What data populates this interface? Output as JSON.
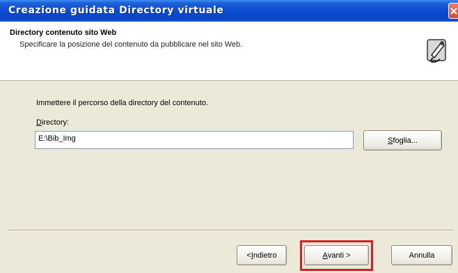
{
  "window": {
    "title": "Creazione guidata Directory virtuale"
  },
  "header": {
    "title": "Directory contenuto sito Web",
    "subtitle": "Specificare la posizione del contenuto da pubblicare nel sito Web."
  },
  "content": {
    "instruction": "Immettere il percorso della directory del contenuto.",
    "directory_label_first": "D",
    "directory_label_rest": "irectory:",
    "directory_value": "E:\\Bib_Img",
    "browse_first": "S",
    "browse_rest": "foglia..."
  },
  "footer": {
    "back_prefix": "< ",
    "back_first": "I",
    "back_rest": "ndietro",
    "next_first": "A",
    "next_rest": "vanti >",
    "cancel_label": "Annulla"
  },
  "colors": {
    "titlebar": "#0a4bd2",
    "highlight": "#d2202a",
    "dialog_bg": "#ece9d8"
  },
  "icons": {
    "close": "close-icon",
    "wizard": "wizard-icon"
  }
}
